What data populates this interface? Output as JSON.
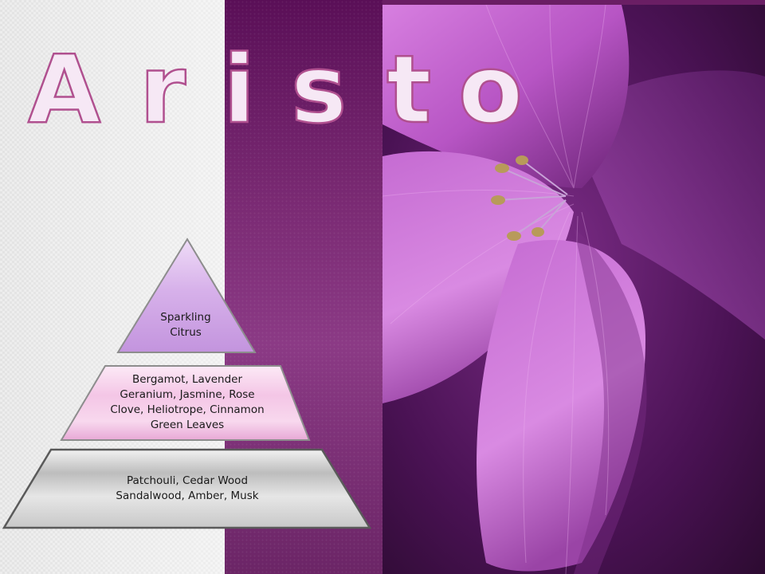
{
  "brand": {
    "title": "Aristo",
    "letters": [
      "A",
      "r",
      "i",
      "s",
      "t",
      "o"
    ]
  },
  "pyramid": {
    "top": {
      "lines": [
        "Sparkling",
        "Citrus"
      ]
    },
    "middle": {
      "lines": [
        "Bergamot, Lavender",
        "Geranium, Jasmine, Rose",
        "Clove, Heliotrope, Cinnamon",
        "Green Leaves"
      ]
    },
    "base": {
      "lines": [
        "Patchouli, Cedar Wood",
        "Sandalwood, Amber, Musk"
      ]
    }
  },
  "colors": {
    "title_fill": "#f6e8f5",
    "title_stroke": "#b0508f",
    "top_tier": "#cfa6e6",
    "middle_tier": "#f2c2e4",
    "base_tier": "#d6d6d6",
    "accent": "#8b2a85"
  },
  "icons": {
    "background_photo": "purple-flower-image",
    "pyramid": "fragrance-pyramid"
  }
}
